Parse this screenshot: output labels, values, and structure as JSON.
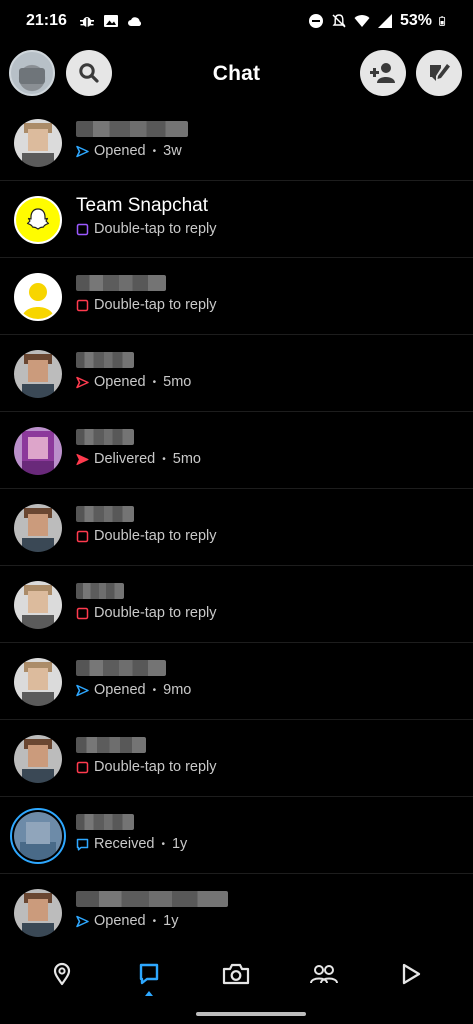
{
  "status_bar": {
    "time": "21:16",
    "battery": "53%"
  },
  "header": {
    "title": "Chat"
  },
  "chats": [
    {
      "name": "",
      "status": "Opened",
      "age": "3w",
      "icon": "sent-arrow-outline",
      "color": "#2ea8ff"
    },
    {
      "name": "Team Snapchat",
      "status": "Double-tap to reply",
      "age": "",
      "icon": "square-outline",
      "color": "#9b59ff"
    },
    {
      "name": "",
      "status": "Double-tap to reply",
      "age": "",
      "icon": "square-outline",
      "color": "#ff3b4e"
    },
    {
      "name": "",
      "status": "Opened",
      "age": "5mo",
      "icon": "sent-arrow-outline",
      "color": "#ff3b4e"
    },
    {
      "name": "",
      "status": "Delivered",
      "age": "5mo",
      "icon": "sent-arrow-filled",
      "color": "#ff3b4e"
    },
    {
      "name": "",
      "status": "Double-tap to reply",
      "age": "",
      "icon": "square-outline",
      "color": "#ff3b4e"
    },
    {
      "name": "",
      "status": "Double-tap to reply",
      "age": "",
      "icon": "square-outline",
      "color": "#ff3b4e"
    },
    {
      "name": "",
      "status": "Opened",
      "age": "9mo",
      "icon": "sent-arrow-outline",
      "color": "#2ea8ff"
    },
    {
      "name": "",
      "status": "Double-tap to reply",
      "age": "",
      "icon": "square-outline",
      "color": "#ff3b4e"
    },
    {
      "name": "",
      "status": "Received",
      "age": "1y",
      "icon": "chat-bubble-outline",
      "color": "#2ea8ff"
    },
    {
      "name": "",
      "status": "Opened",
      "age": "1y",
      "icon": "sent-arrow-outline",
      "color": "#2ea8ff"
    }
  ],
  "separator": "•",
  "colors": {
    "accent_blue": "#2ea8ff",
    "snap_red": "#ff3b4e",
    "snap_purple": "#9b59ff",
    "snap_yellow": "#fffc00"
  },
  "nav": [
    "map-icon",
    "chat-icon",
    "camera-icon",
    "friends-icon",
    "spotlight-play-icon"
  ]
}
